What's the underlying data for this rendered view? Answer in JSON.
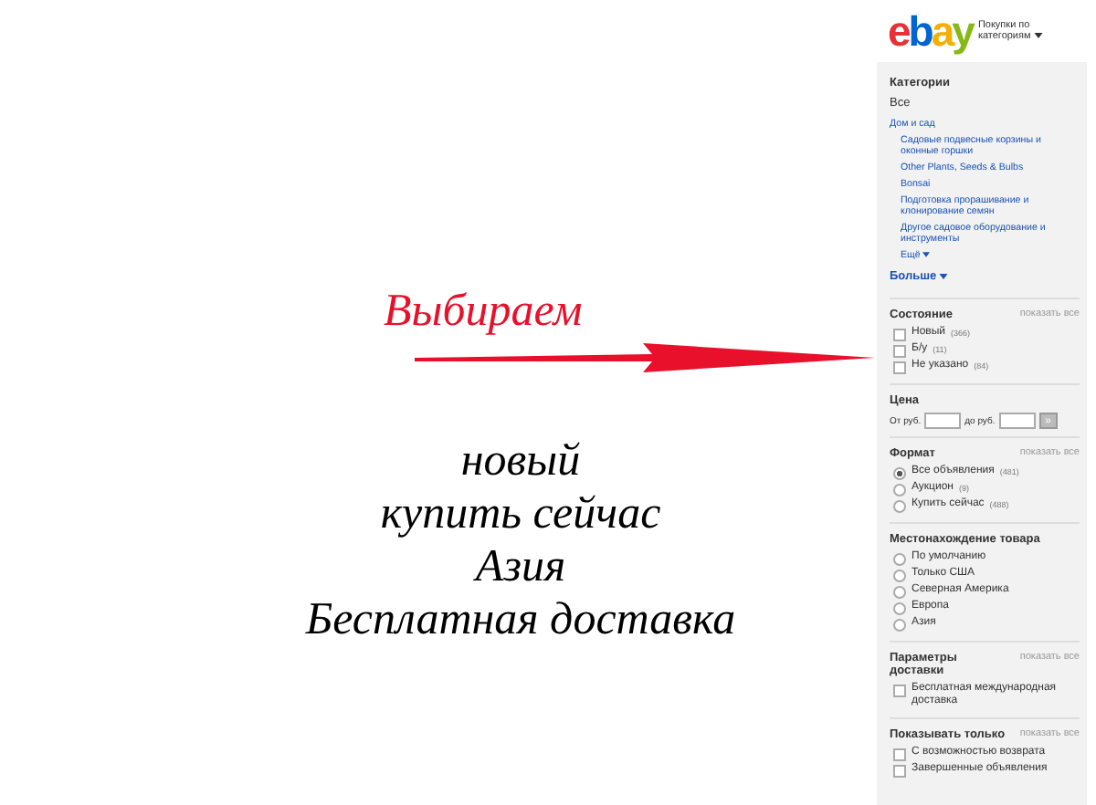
{
  "annotation": {
    "heading": "Выбираем",
    "lines": [
      "новый",
      "купить сейчас",
      "Азия",
      "Бесплатная доставка"
    ]
  },
  "header": {
    "logo": [
      {
        "letter": "e",
        "color": "#e53238"
      },
      {
        "letter": "b",
        "color": "#0064d2"
      },
      {
        "letter": "a",
        "color": "#f5af02"
      },
      {
        "letter": "y",
        "color": "#86b817"
      }
    ],
    "shop_by": "Покупки по категориям"
  },
  "categories": {
    "title": "Категории",
    "all": "Все",
    "parent": "Дом и сад",
    "children": [
      "Садовые подвесные корзины и оконные горшки",
      "Other Plants, Seeds & Bulbs",
      "Bonsai",
      "Подготовка прорашивание и клонирование семян",
      "Другое садовое оборудование и инструменты"
    ],
    "less": "Ещё",
    "more": "Больше"
  },
  "sections": [
    {
      "kind": "checks",
      "title": "Состояние",
      "show_all": "показать все",
      "options": [
        {
          "label": "Новый",
          "count": "(366)",
          "checked": false
        },
        {
          "label": "Б/у",
          "count": "(11)",
          "checked": false
        },
        {
          "label": "Не указано",
          "count": "(84)",
          "checked": false
        }
      ]
    },
    {
      "kind": "price",
      "title": "Цена",
      "from": "От руб.",
      "to": "до руб.",
      "go": "»"
    },
    {
      "kind": "radios",
      "title": "Формат",
      "show_all": "показать все",
      "options": [
        {
          "label": "Все объявления",
          "count": "(481)",
          "selected": true
        },
        {
          "label": "Аукцион",
          "count": "(9)",
          "selected": false
        },
        {
          "label": "Купить сейчас",
          "count": "(488)",
          "selected": false
        }
      ]
    },
    {
      "kind": "radios",
      "title": "Местонахождение товара",
      "options": [
        {
          "label": "По умолчанию",
          "selected": false
        },
        {
          "label": "Только США",
          "selected": false
        },
        {
          "label": "Северная Америка",
          "selected": false
        },
        {
          "label": "Европа",
          "selected": false
        },
        {
          "label": "Азия",
          "selected": false
        }
      ]
    },
    {
      "kind": "checks",
      "title": "Параметры доставки",
      "show_all": "показать все",
      "options": [
        {
          "label": "Бесплатная международная доставка",
          "checked": false
        }
      ]
    },
    {
      "kind": "checks",
      "title": "Показывать только",
      "show_all": "показать все",
      "options": [
        {
          "label": "С возможностью возврата",
          "checked": false
        },
        {
          "label": "Завершенные объявления",
          "checked": false
        }
      ]
    }
  ]
}
